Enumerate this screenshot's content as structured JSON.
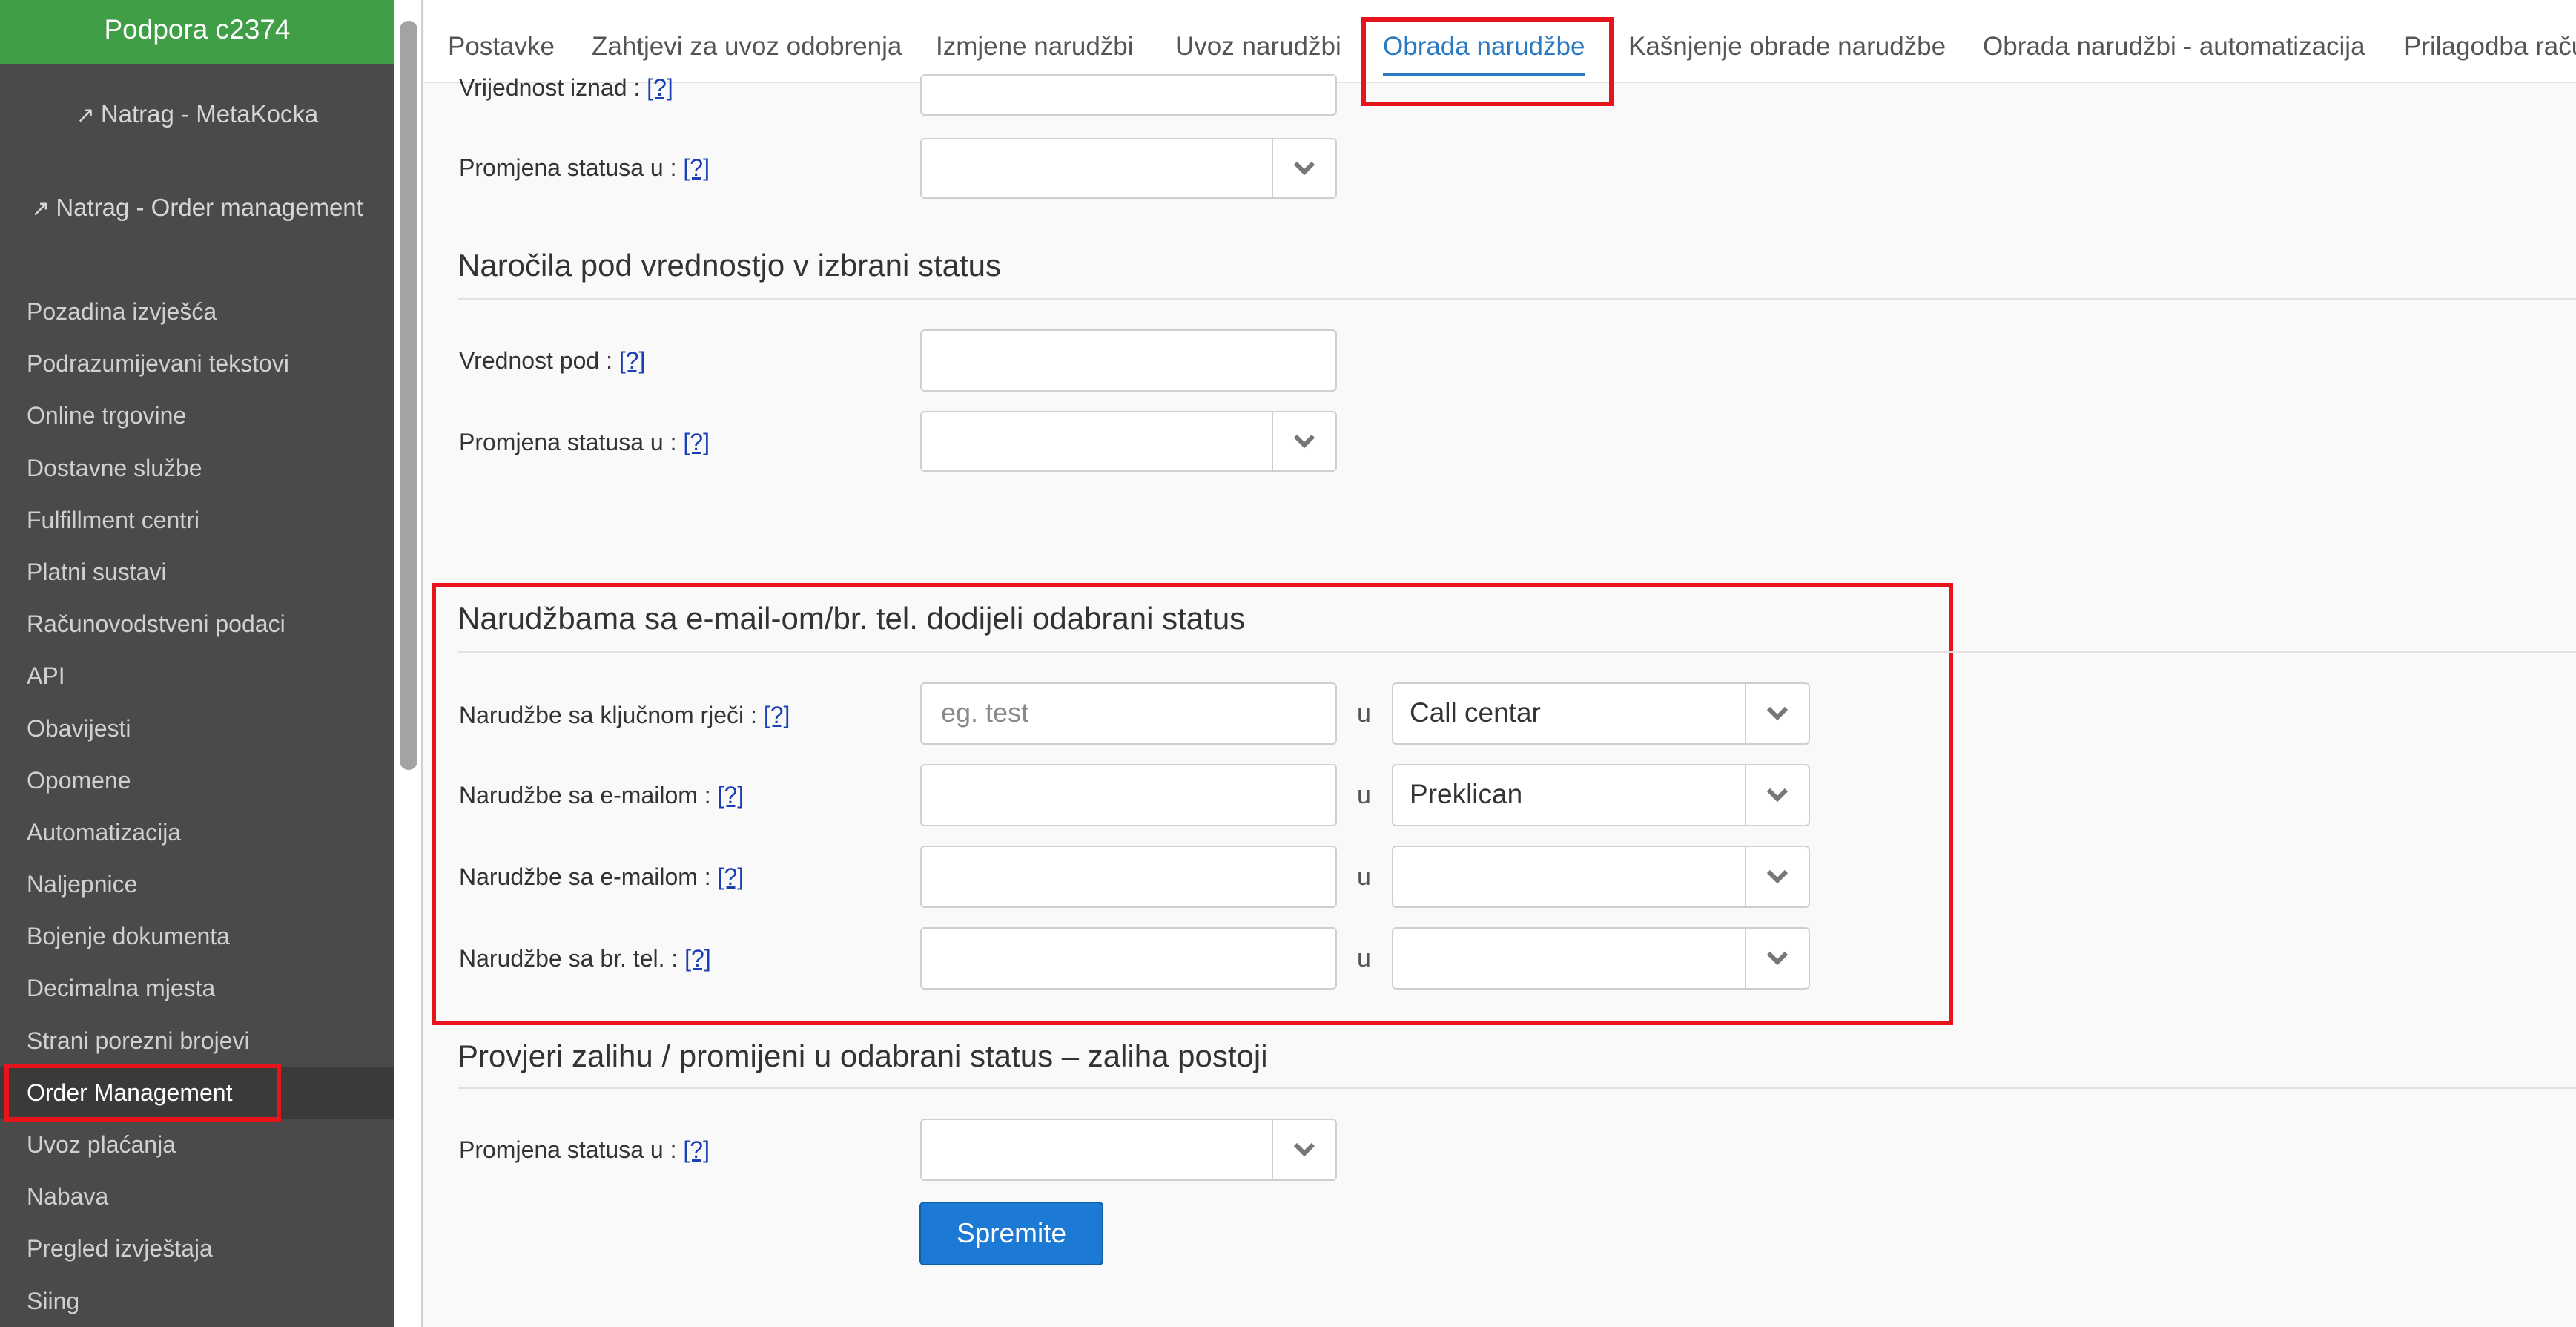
{
  "sidebar": {
    "brand": "Podpora c2374",
    "back_links": [
      "Natrag - MetaKocka",
      "Natrag - Order management"
    ],
    "items": [
      "Pozadina izvješća",
      "Podrazumijevani tekstovi",
      "Online trgovine",
      "Dostavne službe",
      "Fulfillment centri",
      "Platni sustavi",
      "Računovodstveni podaci",
      "API",
      "Obavijesti",
      "Opomene",
      "Automatizacija",
      "Naljepnice",
      "Bojenje dokumenta",
      "Decimalna mjesta",
      "Strani porezni brojevi",
      "Order Management",
      "Uvoz plaćanja",
      "Nabava",
      "Pregled izvještaja",
      "Siing"
    ],
    "active_item": "Order Management"
  },
  "tabs": [
    "Postavke",
    "Zahtjevi za uvoz odobrenja",
    "Izmjene narudžbi",
    "Uvoz narudžbi",
    "Obrada narudžbe",
    "Kašnjenje obrade narudžbe",
    "Obrada narudžbi - automatizacija",
    "Prilagodba raču"
  ],
  "active_tab": "Obrada narudžbe",
  "help_link": "[?]",
  "top_partial": {
    "label_value": "Vrijednost iznad :",
    "label_status": "Promjena statusa u :"
  },
  "section_under": {
    "title": "Naročila pod vrednostjo v izbrani status",
    "label_value": "Vrednost pod :",
    "label_status": "Promjena statusa u :"
  },
  "section_email": {
    "title": "Narudžbama sa e-mail-om/br. tel. dodijeli odabrani status",
    "rows": [
      {
        "label": "Narudžbe sa ključnom rječi :",
        "input_value": "",
        "placeholder": "eg. test",
        "u": "u",
        "status": "Call centar"
      },
      {
        "label": "Narudžbe sa e-mailom :",
        "input_value": "",
        "placeholder": "",
        "u": "u",
        "status": "Preklican"
      },
      {
        "label": "Narudžbe sa e-mailom :",
        "input_value": "",
        "placeholder": "",
        "u": "u",
        "status": ""
      },
      {
        "label": "Narudžbe sa br. tel. :",
        "input_value": "",
        "placeholder": "",
        "u": "u",
        "status": ""
      }
    ]
  },
  "section_stock": {
    "title": "Provjeri zalihu / promijeni u odabrani status – zaliha postoji",
    "label_status": "Promjena statusa u :"
  },
  "save_button": "Spremite",
  "colors": {
    "brand_green": "#3f9e46",
    "sidebar_bg": "#4a4a4a",
    "active_tab": "#2a7ac4",
    "button_blue": "#1c7ad4",
    "highlight_red": "#e8141c"
  }
}
